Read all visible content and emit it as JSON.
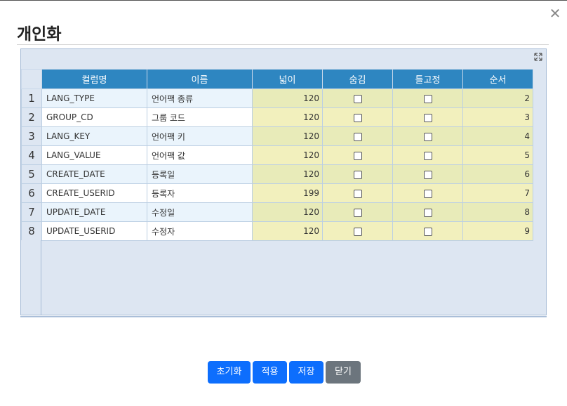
{
  "dialog": {
    "title": "개인화",
    "close_glyph": "✕"
  },
  "grid": {
    "columns": [
      "컬럼명",
      "이름",
      "넓이",
      "숨김",
      "틀고정",
      "순서"
    ],
    "rows": [
      {
        "num": "1",
        "column": "LANG_TYPE",
        "name": "언어팩 종류",
        "width": "120",
        "hidden": false,
        "frozen": false,
        "order": "2"
      },
      {
        "num": "2",
        "column": "GROUP_CD",
        "name": "그룹 코드",
        "width": "120",
        "hidden": false,
        "frozen": false,
        "order": "3"
      },
      {
        "num": "3",
        "column": "LANG_KEY",
        "name": "언어팩 키",
        "width": "120",
        "hidden": false,
        "frozen": false,
        "order": "4"
      },
      {
        "num": "4",
        "column": "LANG_VALUE",
        "name": "언어팩 값",
        "width": "120",
        "hidden": false,
        "frozen": false,
        "order": "5"
      },
      {
        "num": "5",
        "column": "CREATE_DATE",
        "name": "등록일",
        "width": "120",
        "hidden": false,
        "frozen": false,
        "order": "6"
      },
      {
        "num": "6",
        "column": "CREATE_USERID",
        "name": "등록자",
        "width": "199",
        "hidden": false,
        "frozen": false,
        "order": "7"
      },
      {
        "num": "7",
        "column": "UPDATE_DATE",
        "name": "수정일",
        "width": "120",
        "hidden": false,
        "frozen": false,
        "order": "8"
      },
      {
        "num": "8",
        "column": "UPDATE_USERID",
        "name": "수정자",
        "width": "120",
        "hidden": false,
        "frozen": false,
        "order": "9"
      }
    ],
    "expand_icon": "expand-icon"
  },
  "buttons": {
    "reset": "초기화",
    "apply": "적용",
    "save": "저장",
    "close": "닫기"
  },
  "colors": {
    "header": "#2e86c1",
    "primary": "#0d6efd",
    "secondary": "#6c757d",
    "editable_cell": "#f2f0bd"
  }
}
